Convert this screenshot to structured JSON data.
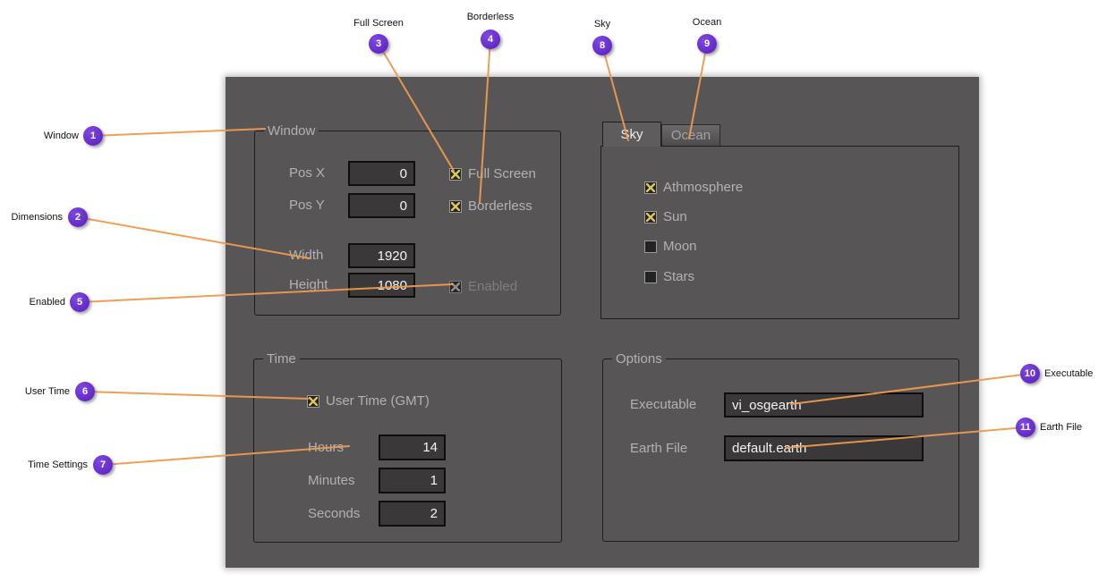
{
  "callouts": {
    "window": {
      "num": "1",
      "label": "Window"
    },
    "dimensions": {
      "num": "2",
      "label": "Dimensions"
    },
    "full_screen": {
      "num": "3",
      "label": "Full Screen"
    },
    "borderless": {
      "num": "4",
      "label": "Borderless"
    },
    "enabled": {
      "num": "5",
      "label": "Enabled"
    },
    "user_time": {
      "num": "6",
      "label": "User Time"
    },
    "time_settings": {
      "num": "7",
      "label": "Time Settings"
    },
    "sky": {
      "num": "8",
      "label": "Sky"
    },
    "ocean": {
      "num": "9",
      "label": "Ocean"
    },
    "executable": {
      "num": "10",
      "label": "Executable"
    },
    "earth_file": {
      "num": "11",
      "label": "Earth File"
    }
  },
  "window_group": {
    "title": "Window",
    "rows": [
      {
        "label": "Pos X",
        "value": "0"
      },
      {
        "label": "Pos Y",
        "value": "0"
      },
      {
        "label": "Width",
        "value": "1920"
      },
      {
        "label": "Height",
        "value": "1080"
      }
    ],
    "checkboxes": [
      {
        "label": "Full Screen",
        "checked": true,
        "disabled": false
      },
      {
        "label": "Borderless",
        "checked": true,
        "disabled": false
      },
      {
        "label": "Enabled",
        "checked": true,
        "disabled": true
      }
    ]
  },
  "sky_panel": {
    "tabs": [
      {
        "label": "Sky",
        "active": true
      },
      {
        "label": "Ocean",
        "active": false
      }
    ],
    "checkboxes": [
      {
        "label": "Athmosphere",
        "checked": true
      },
      {
        "label": "Sun",
        "checked": true
      },
      {
        "label": "Moon",
        "checked": false
      },
      {
        "label": "Stars",
        "checked": false
      }
    ]
  },
  "time_group": {
    "title": "Time",
    "user_time": {
      "label": "User Time (GMT)",
      "checked": true
    },
    "rows": [
      {
        "label": "Hours",
        "value": "14"
      },
      {
        "label": "Minutes",
        "value": "1"
      },
      {
        "label": "Seconds",
        "value": "2"
      }
    ]
  },
  "options_group": {
    "title": "Options",
    "fields": [
      {
        "label": "Executable",
        "value": "vi_osgearth"
      },
      {
        "label": "Earth File",
        "value": "default.earth"
      }
    ]
  },
  "colors": {
    "panel_bg": "#585556",
    "accent_line": "#ee9a4e",
    "badge": "#6b32d4",
    "check_x": "#d9c35a",
    "input_bg": "#3a3839",
    "label_text": "#b3b1b2"
  }
}
